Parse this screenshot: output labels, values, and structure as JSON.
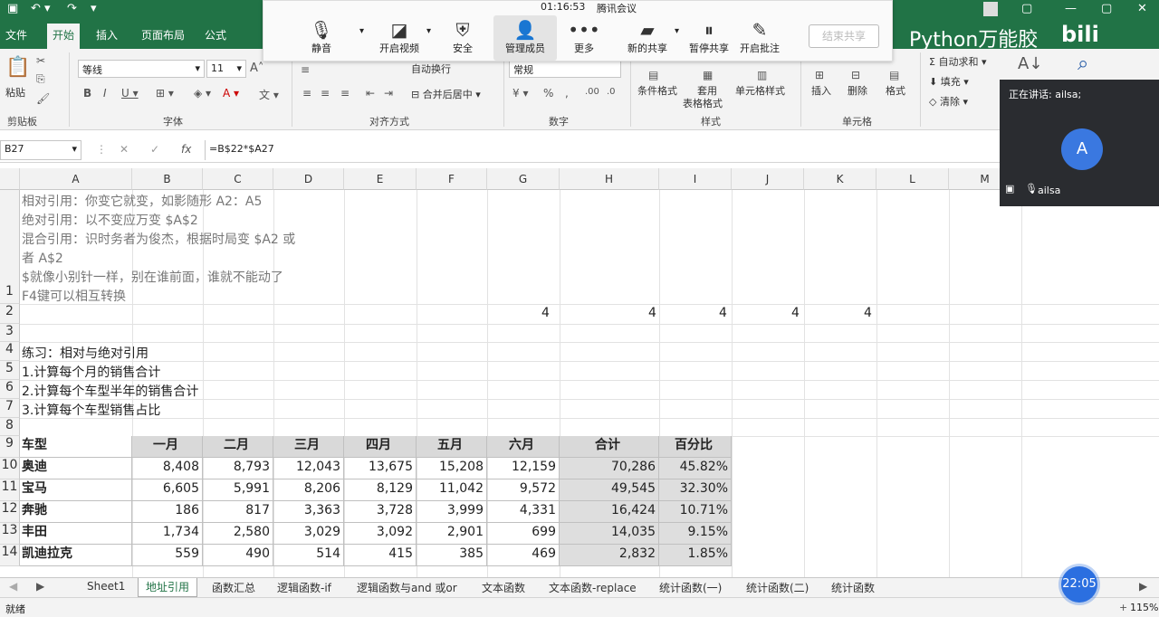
{
  "titlebar": {
    "save_icon": "save-icon",
    "undo_icon": "undo-icon"
  },
  "ribbon_tabs": [
    "文件",
    "开始",
    "插入",
    "页面布局",
    "公式"
  ],
  "ribbon": {
    "paste": "粘贴",
    "clipboard": "剪贴板",
    "font_name": "等线",
    "font_size": "11",
    "font_group": "字体",
    "wrap": "自动换行",
    "merge": "合并后居中",
    "align_group": "对齐方式",
    "num_format": "常规",
    "number_group": "数字",
    "cond_format": "条件格式",
    "table_format_1": "套用",
    "table_format_2": "表格格式",
    "cell_style": "单元格样式",
    "style_group": "样式",
    "insert": "插入",
    "delete": "删除",
    "format": "格式",
    "cells_group": "单元格",
    "autosum": "自动求和",
    "fill": "填充",
    "clear": "清除"
  },
  "watermark": "Python万能胶",
  "formula_bar": {
    "name_box": "B27",
    "formula": "=B$22*$A27"
  },
  "columns": [
    "A",
    "B",
    "C",
    "D",
    "E",
    "F",
    "G",
    "H",
    "I",
    "J",
    "K",
    "L",
    "M"
  ],
  "notes": [
    "相对引用：你变它就变，如影随形 A2：A5",
    "绝对引用：以不变应万变 $A$2",
    "混合引用：识时务者为俊杰，根据时局变 $A2 或",
    "者 A$2",
    "$就像小别针一样，别在谁前面，谁就不能动了",
    "F4键可以相互转换"
  ],
  "row_labels": [
    "1",
    "2",
    "3",
    "4",
    "5",
    "6",
    "7",
    "8",
    "9",
    "10",
    "11",
    "12",
    "13",
    "14"
  ],
  "row2_values": [
    "4",
    "4",
    "4",
    "4",
    "4"
  ],
  "exercise": [
    "练习：相对与绝对引用",
    "1.计算每个月的销售合计",
    "2.计算每个车型半年的销售合计",
    "3.计算每个车型销售占比"
  ],
  "table": {
    "headers": [
      "车型",
      "一月",
      "二月",
      "三月",
      "四月",
      "五月",
      "六月",
      "合计",
      "百分比"
    ],
    "rows": [
      [
        "奥迪",
        "8,408",
        "8,793",
        "12,043",
        "13,675",
        "15,208",
        "12,159",
        "70,286",
        "45.82%"
      ],
      [
        "宝马",
        "6,605",
        "5,991",
        "8,206",
        "8,129",
        "11,042",
        "9,572",
        "49,545",
        "32.30%"
      ],
      [
        "奔驰",
        "186",
        "817",
        "3,363",
        "3,728",
        "3,999",
        "4,331",
        "16,424",
        "10.71%"
      ],
      [
        "丰田",
        "1,734",
        "2,580",
        "3,029",
        "3,092",
        "2,901",
        "699",
        "14,035",
        "9.15%"
      ],
      [
        "凯迪拉克",
        "559",
        "490",
        "514",
        "415",
        "385",
        "469",
        "2,832",
        "1.85%"
      ]
    ]
  },
  "sheet_tabs": [
    "Sheet1",
    "地址引用",
    "函数汇总",
    "逻辑函数-if",
    "逻辑函数与and 或or",
    "文本函数",
    "文本函数-replace",
    "统计函数(一)",
    "统计函数(二)",
    "统计函数"
  ],
  "active_sheet_index": 1,
  "status": {
    "mode": "就绪",
    "zoom": "115%"
  },
  "meeting": {
    "clock": "01:16:53",
    "app": "腾讯会议",
    "buttons": [
      "静音",
      "开启视频",
      "安全",
      "管理成员",
      "更多",
      "新的共享",
      "暂停共享",
      "开启批注"
    ],
    "end_share": "结束共享",
    "speaking": "正在讲话: ailsa;",
    "avatar_letter": "A",
    "participant": "ailsa",
    "timer": "22:05"
  }
}
